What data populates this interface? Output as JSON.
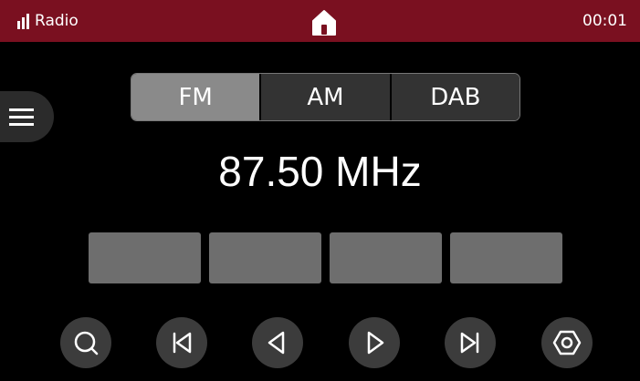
{
  "status_bar": {
    "app_title": "Radio",
    "time": "00:01",
    "background_color": "#7a1020"
  },
  "band_selector": {
    "tabs": [
      {
        "label": "FM",
        "active": true
      },
      {
        "label": "AM",
        "active": false
      },
      {
        "label": "DAB",
        "active": false
      }
    ]
  },
  "tuner": {
    "frequency": "87.50 MHz"
  },
  "presets": [
    {
      "label": ""
    },
    {
      "label": ""
    },
    {
      "label": ""
    },
    {
      "label": ""
    }
  ],
  "controls": [
    {
      "icon": "search-icon"
    },
    {
      "icon": "skip-previous-icon"
    },
    {
      "icon": "seek-back-icon"
    },
    {
      "icon": "seek-forward-icon"
    },
    {
      "icon": "skip-next-icon"
    },
    {
      "icon": "settings-icon"
    }
  ]
}
